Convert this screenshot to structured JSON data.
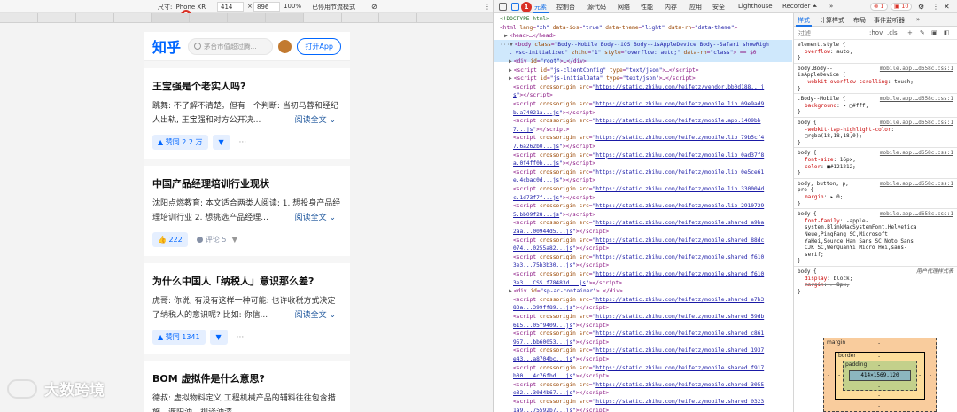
{
  "device_toolbar": {
    "size_label": "尺寸: iPhone XR",
    "width": "414",
    "times": "×",
    "height": "896",
    "zoom": "100%",
    "throttle": "已停用节流模式",
    "badge_num": "2"
  },
  "zhihu": {
    "logo": "知乎",
    "search_placeholder": "茅台市值超过腾...",
    "open_app": "打开App",
    "cards": [
      {
        "title": "王宝强是个老实人吗?",
        "body": "跳舞: 不了解不清楚。但有一个判断: 当初马蓉和经纪人出轨, 王宝强和对方公开决...",
        "read_more": "阅读全文 ⌄",
        "vote": "▲ 赞同 2.2 万",
        "vote_down": "▼",
        "more": "···"
      },
      {
        "title": "中国产品经理培训行业现状",
        "body": "沈阳点燃教育: 本文适合两类人阅读: 1. 想投身产品经理培训行业 2. 想挑选产品经理...",
        "read_more": "阅读全文 ⌄",
        "vote": "👍 222",
        "comment": "评论 5",
        "vote_down": "▼"
      },
      {
        "title": "为什么中国人「纳税人」意识那么差?",
        "body": "虎哥: 你说, 有没有这样一种可能: 也许收税方式决定了纳税人的意识呢? 比如: 你信...",
        "read_more": "阅读全文 ⌄",
        "vote": "▲ 赞同 1341",
        "vote_down": "▼",
        "more": "···"
      },
      {
        "title": "BOM 虚拟件是什么意思?",
        "body": "德叔: 虚拟物料定义 工程机械产品的辅料往往包含措施、遮阳油、视译油漆...",
        "read_more": "",
        "vote": "",
        "vote_down": "",
        "more": ""
      }
    ]
  },
  "watermark": {
    "text": "大数跨境"
  },
  "devtools": {
    "tabs": [
      "元素",
      "控制台",
      "源代码",
      "网络",
      "性能",
      "内存",
      "应用",
      "安全",
      "Lighthouse",
      "Recorder ⏶",
      "»"
    ],
    "badge_num": "1",
    "errors": "⊗ 1",
    "warnings": "▣ 10",
    "elements_lines": [
      {
        "i": 0,
        "html": "<span class=\"cm\">&lt;!DOCTYPE html&gt;</span>"
      },
      {
        "i": 0,
        "html": "<span class=\"tg\">&lt;html</span> <span class=\"an\">lang</span>=<span class=\"av\">\"zh\"</span> <span class=\"an\">data-ios</span>=<span class=\"av\">\"true\"</span> <span class=\"an\">data-theme</span>=<span class=\"av\">\"light\"</span> <span class=\"an\">data-rh</span>=<span class=\"av\">\"data-theme\"</span><span class=\"tg\">&gt;</span>"
      },
      {
        "i": 1,
        "html": "<span class=\"tri\">▶</span><span class=\"tg\">&lt;head&gt;</span>…<span class=\"tg\">&lt;/head&gt;</span>"
      },
      {
        "i": 0,
        "html": "<span class=\"tri\">···▼</span><span class=\"tg\">&lt;body</span> <span class=\"an\">class</span>=<span class=\"av\">\"Body--Mobile Body--iOS Body--isAppleDevice Body--Safari showRigh</span>"
      },
      {
        "i": 2,
        "html": "<span class=\"av\">t vsc-initialized\"</span> <span class=\"an\">zhihu</span>=<span class=\"av\">\"1\"</span> <span class=\"an\">style</span>=<span class=\"av\">\"overflow: auto;\"</span> <span class=\"an\">data-rh</span>=<span class=\"av\">\"class\"</span><span class=\"tg\">&gt;</span> == $0"
      },
      {
        "i": 2,
        "html": "<span class=\"tri\">▶</span><span class=\"tg\">&lt;div</span> <span class=\"an\">id</span>=<span class=\"av\">\"root\"</span><span class=\"tg\">&gt;</span>…<span class=\"tg\">&lt;/div&gt;</span>"
      },
      {
        "i": 2,
        "html": "<span class=\"tri\">▶</span><span class=\"tg\">&lt;script</span> <span class=\"an\">id</span>=<span class=\"av\">\"js-clientConfig\"</span> <span class=\"an\">type</span>=<span class=\"av\">\"text/json\"</span><span class=\"tg\">&gt;</span>…<span class=\"tg\">&lt;/script&gt;</span>"
      },
      {
        "i": 2,
        "html": "<span class=\"tri\">▶</span><span class=\"tg\">&lt;script</span> <span class=\"an\">id</span>=<span class=\"av\">\"js-initialData\"</span> <span class=\"an\">type</span>=<span class=\"av\">\"text/json\"</span><span class=\"tg\">&gt;</span>…<span class=\"tg\">&lt;/script&gt;</span>"
      },
      {
        "i": 3,
        "html": "<span class=\"tg\">&lt;script</span> <span class=\"an\">crossorigin</span> <span class=\"an\">src</span>=<span class=\"av\">\"</span><span class=\"lk\">https://static.zhihu.com/heifetz/vendor.bb0d188...j</span>"
      },
      {
        "i": 3,
        "html": "<span class=\"lk\">s</span><span class=\"av\">\"</span><span class=\"tg\">&gt;&lt;/script&gt;</span>"
      },
      {
        "i": 3,
        "html": "<span class=\"tg\">&lt;script</span> <span class=\"an\">crossorigin</span> <span class=\"an\">src</span>=<span class=\"av\">\"</span><span class=\"lk\">https://static.zhihu.com/heifetz/mobile.lib_09e9ad9</span>"
      },
      {
        "i": 3,
        "html": "<span class=\"lk\">b.a74021a...js</span><span class=\"av\">\"</span><span class=\"tg\">&gt;&lt;/script&gt;</span>"
      },
      {
        "i": 3,
        "html": "<span class=\"tg\">&lt;script</span> <span class=\"an\">crossorigin</span> <span class=\"an\">src</span>=<span class=\"av\">\"</span><span class=\"lk\">https://static.zhihu.com/heifetz/mobile.app.1409bb</span>"
      },
      {
        "i": 3,
        "html": "<span class=\"lk\">7...js</span><span class=\"av\">\"</span><span class=\"tg\">&gt;&lt;/script&gt;</span>"
      },
      {
        "i": 3,
        "html": "<span class=\"tg\">&lt;script</span> <span class=\"an\">crossorigin</span> <span class=\"an\">src</span>=<span class=\"av\">\"</span><span class=\"lk\">https://static.zhihu.com/heifetz/mobile.lib_79b5cf4</span>"
      },
      {
        "i": 3,
        "html": "<span class=\"lk\">7.6a262b0...js</span><span class=\"av\">\"</span><span class=\"tg\">&gt;&lt;/script&gt;</span>"
      },
      {
        "i": 3,
        "html": "<span class=\"tg\">&lt;script</span> <span class=\"an\">crossorigin</span> <span class=\"an\">src</span>=<span class=\"av\">\"</span><span class=\"lk\">https://static.zhihu.com/heifetz/mobile.lib_0ad37f8</span>"
      },
      {
        "i": 3,
        "html": "<span class=\"lk\">a.0f4ff0b...js</span><span class=\"av\">\"</span><span class=\"tg\">&gt;&lt;/script&gt;</span>"
      },
      {
        "i": 3,
        "html": "<span class=\"tg\">&lt;script</span> <span class=\"an\">crossorigin</span> <span class=\"an\">src</span>=<span class=\"av\">\"</span><span class=\"lk\">https://static.zhihu.com/heifetz/mobile.lib_0e5ce61</span>"
      },
      {
        "i": 3,
        "html": "<span class=\"lk\">e.4cbac0d...js</span><span class=\"av\">\"</span><span class=\"tg\">&gt;&lt;/script&gt;</span>"
      },
      {
        "i": 3,
        "html": "<span class=\"tg\">&lt;script</span> <span class=\"an\">crossorigin</span> <span class=\"an\">src</span>=<span class=\"av\">\"</span><span class=\"lk\">https://static.zhihu.com/heifetz/mobile.lib_330004d</span>"
      },
      {
        "i": 3,
        "html": "<span class=\"lk\">c.1d73f7f...js</span><span class=\"av\">\"</span><span class=\"tg\">&gt;&lt;/script&gt;</span>"
      },
      {
        "i": 3,
        "html": "<span class=\"tg\">&lt;script</span> <span class=\"an\">crossorigin</span> <span class=\"an\">src</span>=<span class=\"av\">\"</span><span class=\"lk\">https://static.zhihu.com/heifetz/mobile.lib_2910729</span>"
      },
      {
        "i": 3,
        "html": "<span class=\"lk\">5.bb09f28...js</span><span class=\"av\">\"</span><span class=\"tg\">&gt;&lt;/script&gt;</span>"
      },
      {
        "i": 3,
        "html": "<span class=\"tg\">&lt;script</span> <span class=\"an\">crossorigin</span> <span class=\"an\">src</span>=<span class=\"av\">\"</span><span class=\"lk\">https://static.zhihu.com/heifetz/mobile.shared_a9ba</span>"
      },
      {
        "i": 3,
        "html": "<span class=\"lk\">2aa...00944d5...js</span><span class=\"av\">\"</span><span class=\"tg\">&gt;&lt;/script&gt;</span>"
      },
      {
        "i": 3,
        "html": "<span class=\"tg\">&lt;script</span> <span class=\"an\">crossorigin</span> <span class=\"an\">src</span>=<span class=\"av\">\"</span><span class=\"lk\">https://static.zhihu.com/heifetz/mobile.shared_88dc</span>"
      },
      {
        "i": 3,
        "html": "<span class=\"lk\">074...0255a82...js</span><span class=\"av\">\"</span><span class=\"tg\">&gt;&lt;/script&gt;</span>"
      },
      {
        "i": 3,
        "html": "<span class=\"tg\">&lt;script</span> <span class=\"an\">crossorigin</span> <span class=\"an\">src</span>=<span class=\"av\">\"</span><span class=\"lk\">https://static.zhihu.com/heifetz/mobile.shared_f610</span>"
      },
      {
        "i": 3,
        "html": "<span class=\"lk\">3e3...75b3b30...js</span><span class=\"av\">\"</span><span class=\"tg\">&gt;&lt;/script&gt;</span>"
      },
      {
        "i": 3,
        "html": "<span class=\"tg\">&lt;script</span> <span class=\"an\">crossorigin</span> <span class=\"an\">src</span>=<span class=\"av\">\"</span><span class=\"lk\">https://static.zhihu.com/heifetz/mobile.shared_f610</span>"
      },
      {
        "i": 3,
        "html": "<span class=\"lk\">3e3...CSS.f78483d...js</span><span class=\"av\">\"</span><span class=\"tg\">&gt;&lt;/script&gt;</span>"
      },
      {
        "i": 2,
        "html": "<span class=\"tri\">▶</span><span class=\"tg\">&lt;div</span> <span class=\"an\">id</span>=<span class=\"av\">\"sp-ac-container\"</span><span class=\"tg\">&gt;</span>…<span class=\"tg\">&lt;/div&gt;</span>"
      },
      {
        "i": 3,
        "html": "<span class=\"tg\">&lt;script</span> <span class=\"an\">crossorigin</span> <span class=\"an\">src</span>=<span class=\"av\">\"</span><span class=\"lk\">https://static.zhihu.com/heifetz/mobile.shared_e7b3</span>"
      },
      {
        "i": 3,
        "html": "<span class=\"lk\">83a...399ff89...js</span><span class=\"av\">\"</span><span class=\"tg\">&gt;&lt;/script&gt;</span>"
      },
      {
        "i": 3,
        "html": "<span class=\"tg\">&lt;script</span> <span class=\"an\">crossorigin</span> <span class=\"an\">src</span>=<span class=\"av\">\"</span><span class=\"lk\">https://static.zhihu.com/heifetz/mobile.shared_59db</span>"
      },
      {
        "i": 3,
        "html": "<span class=\"lk\">615...05f9409...js</span><span class=\"av\">\"</span><span class=\"tg\">&gt;&lt;/script&gt;</span>"
      },
      {
        "i": 3,
        "html": "<span class=\"tg\">&lt;script</span> <span class=\"an\">crossorigin</span> <span class=\"an\">src</span>=<span class=\"av\">\"</span><span class=\"lk\">https://static.zhihu.com/heifetz/mobile.shared_c861</span>"
      },
      {
        "i": 3,
        "html": "<span class=\"lk\">957...bb60053...js</span><span class=\"av\">\"</span><span class=\"tg\">&gt;&lt;/script&gt;</span>"
      },
      {
        "i": 3,
        "html": "<span class=\"tg\">&lt;script</span> <span class=\"an\">crossorigin</span> <span class=\"an\">src</span>=<span class=\"av\">\"</span><span class=\"lk\">https://static.zhihu.com/heifetz/mobile.shared_1937</span>"
      },
      {
        "i": 3,
        "html": "<span class=\"lk\">e43...a8704bc...js</span><span class=\"av\">\"</span><span class=\"tg\">&gt;&lt;/script&gt;</span>"
      },
      {
        "i": 3,
        "html": "<span class=\"tg\">&lt;script</span> <span class=\"an\">crossorigin</span> <span class=\"an\">src</span>=<span class=\"av\">\"</span><span class=\"lk\">https://static.zhihu.com/heifetz/mobile.shared_f917</span>"
      },
      {
        "i": 3,
        "html": "<span class=\"lk\">b00...4c76fbd...js</span><span class=\"av\">\"</span><span class=\"tg\">&gt;&lt;/script&gt;</span>"
      },
      {
        "i": 3,
        "html": "<span class=\"tg\">&lt;script</span> <span class=\"an\">crossorigin</span> <span class=\"an\">src</span>=<span class=\"av\">\"</span><span class=\"lk\">https://static.zhihu.com/heifetz/mobile.shared_3055</span>"
      },
      {
        "i": 3,
        "html": "<span class=\"lk\">e32...30d4b67...js</span><span class=\"av\">\"</span><span class=\"tg\">&gt;&lt;/script&gt;</span>"
      },
      {
        "i": 3,
        "html": "<span class=\"tg\">&lt;script</span> <span class=\"an\">crossorigin</span> <span class=\"an\">src</span>=<span class=\"av\">\"</span><span class=\"lk\">https://static.zhihu.com/heifetz/mobile.shared_0323</span>"
      },
      {
        "i": 3,
        "html": "<span class=\"lk\">1a9...75592b7...js</span><span class=\"av\">\"</span><span class=\"tg\">&gt;&lt;/script&gt;</span>"
      }
    ],
    "styles_tabs": [
      "样式",
      "计算样式",
      "布局",
      "事件监听器",
      "»"
    ],
    "filter_placeholder": "过滤",
    "filter_hov": ":hov",
    "filter_cls": ".cls",
    "filter_plus": "+",
    "rules": [
      {
        "sel": "element.style {",
        "src": ""
      },
      {
        "prop": "overflow",
        "val": "auto;"
      },
      {
        "close": "}"
      },
      {
        "sel": "body.Body--",
        "src": "mobile.app.…d658c.css:1"
      },
      {
        "sel": "isAppleDevice {",
        "src": ""
      },
      {
        "prop": "-webkit-overflow-scrolling",
        "val": "touch;",
        "strike": true
      },
      {
        "close": "}"
      },
      {
        "sel": ".Body--Mobile {",
        "src": "mobile.app.…d658c.css:1"
      },
      {
        "prop": "background",
        "val": "▸ □#fff;"
      },
      {
        "close": "}"
      },
      {
        "sel": "body {",
        "src": "mobile.app.…d658c.css:1"
      },
      {
        "prop": "-webkit-tap-highlight-color",
        "val": ""
      },
      {
        "cont": "  □rgba(18,18,18,0);"
      },
      {
        "close": "}"
      },
      {
        "sel": "body {",
        "src": "mobile.app.…d658c.css:1"
      },
      {
        "prop": "font-size",
        "val": "16px;"
      },
      {
        "prop": "color",
        "val": "■#121212;"
      },
      {
        "close": "}"
      },
      {
        "sel": "body, button, p,",
        "src": "mobile.app.…d658c.css:1"
      },
      {
        "sel": "pre {",
        "src": ""
      },
      {
        "prop": "margin",
        "val": "▸ 0;"
      },
      {
        "close": "}"
      },
      {
        "sel": "body {",
        "src": "mobile.app.…d658c.css:1"
      },
      {
        "prop": "font-family",
        "val": "-apple-"
      },
      {
        "cont": "    system,BlinkMacSystemFont,Helvetica"
      },
      {
        "cont": "    Neue,PingFang SC,Microsoft"
      },
      {
        "cont": "    YaHei,Source Han Sans SC,Noto Sans"
      },
      {
        "cont": "    CJK SC,WenQuanYi Micro Hei,sans-"
      },
      {
        "cont": "    serif;"
      },
      {
        "close": "}"
      },
      {
        "sel": "body {",
        "src": "用户代理样式表",
        "italic": true
      },
      {
        "prop": "display",
        "val": "block;"
      },
      {
        "prop": "margin",
        "val": "▸ 8px;",
        "strike": true
      },
      {
        "close": "}"
      }
    ],
    "boxmodel": {
      "margin": "margin",
      "border": "border",
      "padding": "padding",
      "content": "414×1569.120",
      "dash": "-"
    }
  }
}
